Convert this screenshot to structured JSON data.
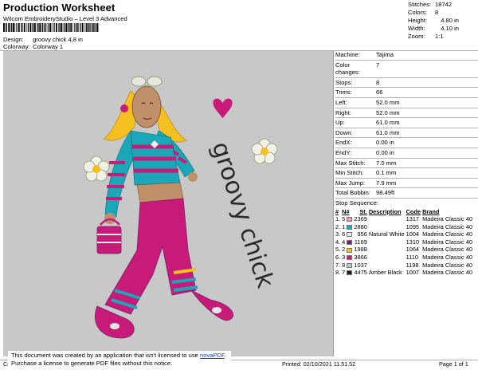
{
  "header": {
    "title": "Production Worksheet",
    "subtitle": "Wilcom EmbroideryStudio – Level 3 Advanced",
    "barcode_text": ",",
    "design_label": "Design:",
    "design_value": "groovy chick 4,8 in",
    "colorway_label": "Colorway:",
    "colorway_value": "Colorway 1"
  },
  "summary": [
    {
      "label": "Stitches:",
      "value": "18742"
    },
    {
      "label": "Colors:",
      "value": "8"
    },
    {
      "label": "Height:",
      "value": "4.80 in"
    },
    {
      "label": "Width:",
      "value": "4.10 in"
    },
    {
      "label": "Zoom:",
      "value": "1:1"
    }
  ],
  "design": {
    "lettering": "groovy chick"
  },
  "machine_info": [
    {
      "label": "Machine:",
      "value": "Tajima"
    },
    {
      "label": "Color changes:",
      "value": "7"
    },
    {
      "label": "Stops:",
      "value": "8"
    },
    {
      "label": "Trims:",
      "value": "66"
    },
    {
      "label": "Left:",
      "value": "52.0 mm"
    },
    {
      "label": "Right:",
      "value": "52.0 mm"
    },
    {
      "label": "Up:",
      "value": "61.0 mm"
    },
    {
      "label": "Down:",
      "value": "61.0 mm"
    },
    {
      "label": "EndX:",
      "value": "0.00 in"
    },
    {
      "label": "EndY:",
      "value": "0.00 in"
    },
    {
      "label": "Max Stitch:",
      "value": "7.0 mm"
    },
    {
      "label": "Min Stitch:",
      "value": "0.1 mm"
    },
    {
      "label": "Max Jump:",
      "value": "7.9 mm"
    },
    {
      "label": "Total Bobbin:",
      "value": "98.49ft"
    }
  ],
  "stop_sequence": {
    "title": "Stop Sequence:",
    "columns": [
      "#",
      "N#",
      "St.",
      "Description",
      "Code",
      "Brand"
    ],
    "rows": [
      {
        "num": "1.",
        "needle": "5",
        "color": "#e8a0a8",
        "stitches": "2369",
        "description": "",
        "code": "1317",
        "brand": "Madeira Classic 40"
      },
      {
        "num": "2.",
        "needle": "1",
        "color": "#1aa8b8",
        "stitches": "2880",
        "description": "",
        "code": "1095",
        "brand": "Madeira Classic 40"
      },
      {
        "num": "3.",
        "needle": "6",
        "color": "#f2f0e8",
        "stitches": "956",
        "description": "Natural White",
        "code": "1004",
        "brand": "Madeira Classic 40"
      },
      {
        "num": "4.",
        "needle": "4",
        "color": "#7a1a6a",
        "stitches": "1169",
        "description": "",
        "code": "1310",
        "brand": "Madeira Classic 40"
      },
      {
        "num": "5.",
        "needle": "2",
        "color": "#f4c020",
        "stitches": "1988",
        "description": "",
        "code": "1064",
        "brand": "Madeira Classic 40"
      },
      {
        "num": "6.",
        "needle": "3",
        "color": "#c81a78",
        "stitches": "3866",
        "description": "",
        "code": "1110",
        "brand": "Madeira Classic 40"
      },
      {
        "num": "7.",
        "needle": "8",
        "color": "#b8c8d0",
        "stitches": "1037",
        "description": "",
        "code": "1198",
        "brand": "Madeira Classic 40"
      },
      {
        "num": "8.",
        "needle": "7",
        "color": "#1a1a1a",
        "stitches": "4475",
        "description": "Amber Black",
        "code": "1007",
        "brand": "Madeira Classic 40"
      }
    ]
  },
  "footer": {
    "left": "Cr",
    "printed": "Printed: 02/10/2021 11.51.52",
    "page": "Page 1 of 1",
    "notice_line1": "This document was created by an application that isn't licensed to use",
    "notice_link": "novaPDF",
    "notice_line2": "Purchase a license to generate PDF files without this notice."
  }
}
